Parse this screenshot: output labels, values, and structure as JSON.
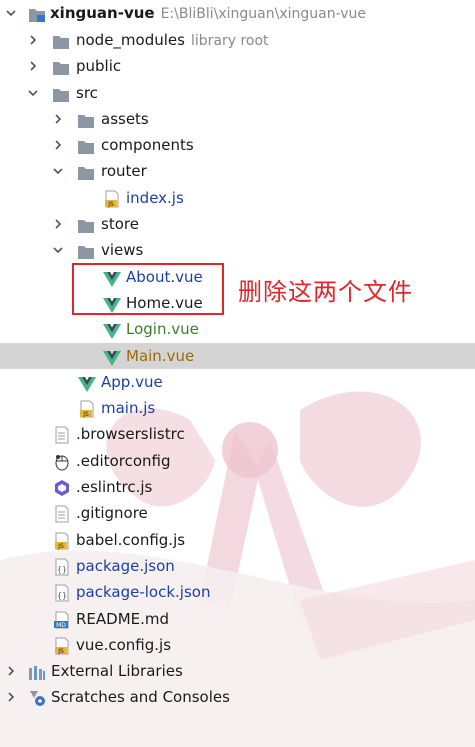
{
  "project": {
    "name": "xinguan-vue",
    "path": "E:\\BliBli\\xinguan\\xinguan-vue"
  },
  "tree": {
    "node_modules": {
      "label": "node_modules",
      "hint": "library root"
    },
    "public": {
      "label": "public"
    },
    "src": {
      "label": "src"
    },
    "assets": {
      "label": "assets"
    },
    "components": {
      "label": "components"
    },
    "router": {
      "label": "router"
    },
    "router_index": {
      "label": "index.js"
    },
    "store": {
      "label": "store"
    },
    "views": {
      "label": "views"
    },
    "about": {
      "label": "About.vue"
    },
    "home": {
      "label": "Home.vue"
    },
    "login": {
      "label": "Login.vue"
    },
    "main_vue": {
      "label": "Main.vue"
    },
    "app": {
      "label": "App.vue"
    },
    "main_js": {
      "label": "main.js"
    },
    "browserslistrc": {
      "label": ".browserslistrc"
    },
    "editorconfig": {
      "label": ".editorconfig"
    },
    "eslintrc": {
      "label": ".eslintrc.js"
    },
    "gitignore": {
      "label": ".gitignore"
    },
    "babel": {
      "label": "babel.config.js"
    },
    "package_json": {
      "label": "package.json"
    },
    "package_lock": {
      "label": "package-lock.json"
    },
    "readme": {
      "label": "README.md"
    },
    "vue_config": {
      "label": "vue.config.js"
    },
    "external": {
      "label": "External Libraries"
    },
    "scratches": {
      "label": "Scratches and Consoles"
    }
  },
  "annotation": {
    "text": "删除这两个文件"
  },
  "icon_badges": {
    "js": "JS",
    "md": "MD",
    "json": "{}"
  },
  "colors": {
    "folder": "#8c97a3",
    "vue_green": "#41b883",
    "vue_dark": "#35495e",
    "js_yellow": "#e8b43a",
    "annotation_red": "#e0262a",
    "selected_row": "#cdcdcd"
  }
}
